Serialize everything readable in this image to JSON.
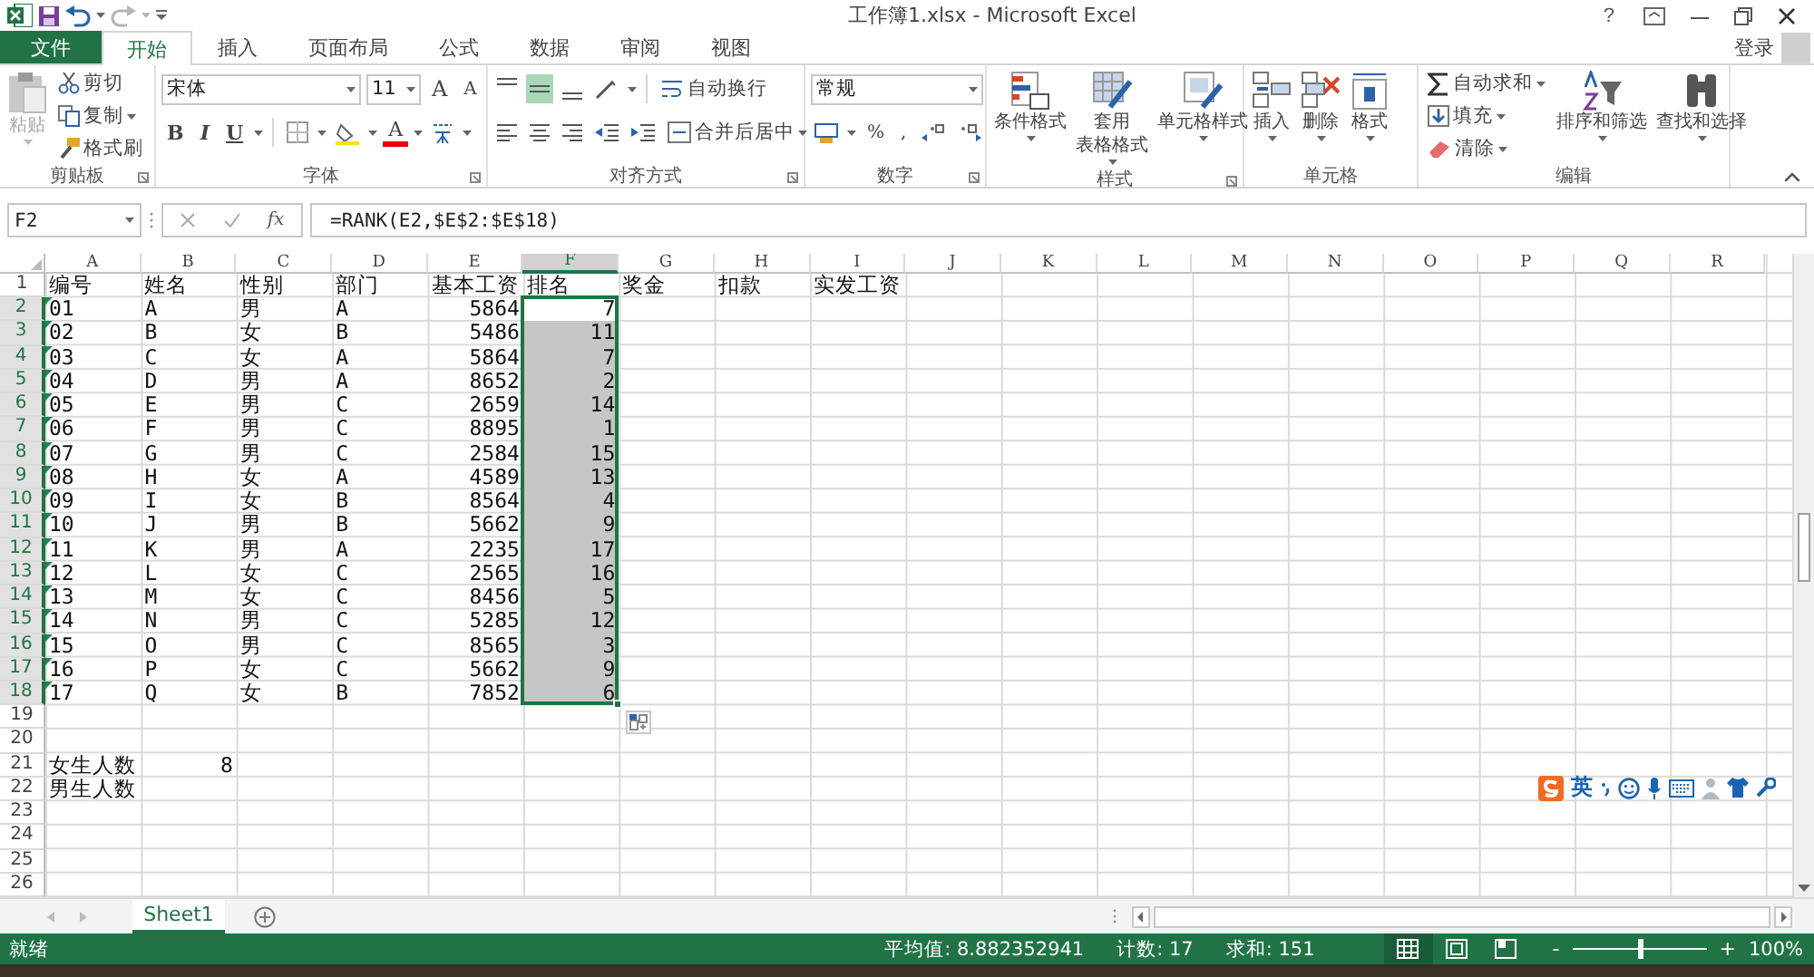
{
  "window": {
    "title": "工作簿1.xlsx - Microsoft Excel",
    "help": "?",
    "sign_in": "登录"
  },
  "tabs": [
    {
      "label": "文件",
      "kind": "file",
      "selected": false
    },
    {
      "label": "开始",
      "kind": "tab",
      "selected": true
    },
    {
      "label": "插入",
      "kind": "tab",
      "selected": false
    },
    {
      "label": "页面布局",
      "kind": "tab",
      "selected": false
    },
    {
      "label": "公式",
      "kind": "tab",
      "selected": false
    },
    {
      "label": "数据",
      "kind": "tab",
      "selected": false
    },
    {
      "label": "审阅",
      "kind": "tab",
      "selected": false
    },
    {
      "label": "视图",
      "kind": "tab",
      "selected": false
    }
  ],
  "ribbon": {
    "clipboard": {
      "label": "剪贴板",
      "paste": {
        "label": "粘贴",
        "disabled": true
      },
      "cut": "剪切",
      "copy": "复制",
      "format_painter": "格式刷"
    },
    "font": {
      "label": "字体",
      "font_name": "宋体",
      "font_size": "11",
      "grow": "A",
      "shrink": "A",
      "bold": "B",
      "italic": "I",
      "underline": "U",
      "font_color": "A"
    },
    "alignment": {
      "label": "对齐方式",
      "vertical_align": [
        {
          "selected": false
        },
        {
          "selected": true
        },
        {
          "selected": false
        }
      ],
      "wrap_text": "自动换行",
      "merge_center": "合并后居中"
    },
    "number": {
      "label": "数字",
      "format": "常规",
      "percent": "%",
      "comma": ","
    },
    "styles": {
      "label": "样式",
      "conditional": "条件格式",
      "table": [
        "套用",
        "表格格式"
      ],
      "cell_styles": "单元格样式"
    },
    "cells": {
      "label": "单元格",
      "insert": "插入",
      "delete": "删除",
      "format": "格式"
    },
    "editing": {
      "label": "编辑",
      "autosum": "自动求和",
      "fill": "填充",
      "clear": "清除",
      "sort_filter": "排序和筛选",
      "find_select": "查找和选择"
    }
  },
  "formula_bar": {
    "name_box": "F2",
    "function_label": "fx",
    "formula": "=RANK(E2,$E$2:$E$18)"
  },
  "sheet": {
    "columns": [
      {
        "label": "A",
        "selected": false
      },
      {
        "label": "B",
        "selected": false
      },
      {
        "label": "C",
        "selected": false
      },
      {
        "label": "D",
        "selected": false
      },
      {
        "label": "E",
        "selected": false
      },
      {
        "label": "F",
        "selected": true
      },
      {
        "label": "G",
        "selected": false
      },
      {
        "label": "H",
        "selected": false
      },
      {
        "label": "I",
        "selected": false
      },
      {
        "label": "J",
        "selected": false
      },
      {
        "label": "K",
        "selected": false
      },
      {
        "label": "L",
        "selected": false
      },
      {
        "label": "M",
        "selected": false
      },
      {
        "label": "N",
        "selected": false
      },
      {
        "label": "O",
        "selected": false
      },
      {
        "label": "P",
        "selected": false
      },
      {
        "label": "Q",
        "selected": false
      },
      {
        "label": "R",
        "selected": false
      }
    ],
    "rows": [
      {
        "label": "1",
        "selected": false,
        "flagged": false,
        "cells": [
          "编号",
          "姓名",
          "性别",
          "部门",
          "基本工资",
          "排名",
          "奖金",
          "扣款",
          "实发工资"
        ]
      },
      {
        "label": "2",
        "selected": true,
        "flagged": true,
        "cells": [
          "01",
          "A",
          "男",
          "A",
          {
            "number": "5864"
          },
          {
            "number": "7",
            "active": true
          }
        ]
      },
      {
        "label": "3",
        "selected": true,
        "flagged": true,
        "cells": [
          "02",
          "B",
          "女",
          "B",
          {
            "number": "5486"
          },
          {
            "number": "11",
            "active": false
          }
        ]
      },
      {
        "label": "4",
        "selected": true,
        "flagged": true,
        "cells": [
          "03",
          "C",
          "女",
          "A",
          {
            "number": "5864"
          },
          {
            "number": "7",
            "active": false
          }
        ]
      },
      {
        "label": "5",
        "selected": true,
        "flagged": true,
        "cells": [
          "04",
          "D",
          "男",
          "A",
          {
            "number": "8652"
          },
          {
            "number": "2",
            "active": false
          }
        ]
      },
      {
        "label": "6",
        "selected": true,
        "flagged": true,
        "cells": [
          "05",
          "E",
          "男",
          "C",
          {
            "number": "2659"
          },
          {
            "number": "14",
            "active": false
          }
        ]
      },
      {
        "label": "7",
        "selected": true,
        "flagged": true,
        "cells": [
          "06",
          "F",
          "男",
          "C",
          {
            "number": "8895"
          },
          {
            "number": "1",
            "active": false
          }
        ]
      },
      {
        "label": "8",
        "selected": true,
        "flagged": true,
        "cells": [
          "07",
          "G",
          "男",
          "C",
          {
            "number": "2584"
          },
          {
            "number": "15",
            "active": false
          }
        ]
      },
      {
        "label": "9",
        "selected": true,
        "flagged": true,
        "cells": [
          "08",
          "H",
          "女",
          "A",
          {
            "number": "4589"
          },
          {
            "number": "13",
            "active": false
          }
        ]
      },
      {
        "label": "10",
        "selected": true,
        "flagged": true,
        "cells": [
          "09",
          "I",
          "女",
          "B",
          {
            "number": "8564"
          },
          {
            "number": "4",
            "active": false
          }
        ]
      },
      {
        "label": "11",
        "selected": true,
        "flagged": true,
        "cells": [
          "10",
          "J",
          "男",
          "B",
          {
            "number": "5662"
          },
          {
            "number": "9",
            "active": false
          }
        ]
      },
      {
        "label": "12",
        "selected": true,
        "flagged": true,
        "cells": [
          "11",
          "K",
          "男",
          "A",
          {
            "number": "2235"
          },
          {
            "number": "17",
            "active": false
          }
        ]
      },
      {
        "label": "13",
        "selected": true,
        "flagged": true,
        "cells": [
          "12",
          "L",
          "女",
          "C",
          {
            "number": "2565"
          },
          {
            "number": "16",
            "active": false
          }
        ]
      },
      {
        "label": "14",
        "selected": true,
        "flagged": true,
        "cells": [
          "13",
          "M",
          "女",
          "C",
          {
            "number": "8456"
          },
          {
            "number": "5",
            "active": false
          }
        ]
      },
      {
        "label": "15",
        "selected": true,
        "flagged": true,
        "cells": [
          "14",
          "N",
          "男",
          "C",
          {
            "number": "5285"
          },
          {
            "number": "12",
            "active": false
          }
        ]
      },
      {
        "label": "16",
        "selected": true,
        "flagged": true,
        "cells": [
          "15",
          "O",
          "男",
          "C",
          {
            "number": "8565"
          },
          {
            "number": "3",
            "active": false
          }
        ]
      },
      {
        "label": "17",
        "selected": true,
        "flagged": true,
        "cells": [
          "16",
          "P",
          "女",
          "C",
          {
            "number": "5662"
          },
          {
            "number": "9",
            "active": false
          }
        ]
      },
      {
        "label": "18",
        "selected": true,
        "flagged": true,
        "cells": [
          "17",
          "Q",
          "女",
          "B",
          {
            "number": "7852"
          },
          {
            "number": "6",
            "active": false
          }
        ]
      },
      {
        "label": "19",
        "selected": false,
        "flagged": false,
        "cells": []
      },
      {
        "label": "20",
        "selected": false,
        "flagged": false,
        "cells": []
      },
      {
        "label": "21",
        "selected": false,
        "flagged": false,
        "cells": [
          "女生人数",
          {
            "number": "8"
          }
        ]
      },
      {
        "label": "22",
        "selected": false,
        "flagged": false,
        "cells": [
          "男生人数"
        ]
      },
      {
        "label": "23",
        "selected": false,
        "flagged": false,
        "cells": []
      },
      {
        "label": "24",
        "selected": false,
        "flagged": false,
        "cells": []
      },
      {
        "label": "25",
        "selected": false,
        "flagged": false,
        "cells": []
      },
      {
        "label": "26",
        "selected": false,
        "flagged": false,
        "cells": []
      }
    ]
  },
  "sheet_tabs": [
    {
      "label": "Sheet1",
      "selected": true
    }
  ],
  "ime_toolbar": {
    "mode": "英"
  },
  "status_bar": {
    "status": "就绪",
    "average": "平均值: 8.882352941",
    "count": "计数: 17",
    "sum": "求和: 151",
    "views": [
      {
        "selected": true
      },
      {
        "selected": false
      },
      {
        "selected": false
      }
    ],
    "zoom": {
      "minus": "-",
      "plus": "+",
      "level": 0.5,
      "reading": "100%"
    }
  }
}
